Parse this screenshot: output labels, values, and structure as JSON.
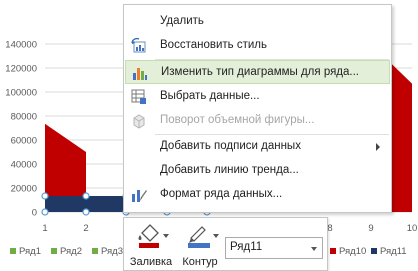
{
  "chart_data": {
    "type": "area",
    "y_ticks": [
      "0",
      "20000",
      "40000",
      "60000",
      "80000",
      "100000",
      "120000",
      "140000"
    ],
    "x_ticks": [
      "1",
      "2",
      "8",
      "9",
      "10"
    ],
    "ylim": [
      0,
      150000
    ],
    "grid": true,
    "legend_position": "bottom",
    "colors": {
      "red": "#c00000",
      "green": "#70ad47",
      "navy": "#203864"
    }
  },
  "legend": [
    {
      "label": "Ряд1",
      "color": "#70ad47"
    },
    {
      "label": "Ряд2",
      "color": "#70ad47"
    },
    {
      "label": "Ряд3",
      "color": "#70ad47"
    },
    {
      "label": "Ряд10",
      "color": "#c00000"
    },
    {
      "label": "Ряд11",
      "color": "#203864"
    }
  ],
  "context_menu": {
    "items": [
      {
        "label": "Удалить",
        "icon": "",
        "state": "normal"
      },
      {
        "label": "Восстановить стиль",
        "icon": "reset-style-icon",
        "state": "normal"
      },
      {
        "label": "Изменить тип диаграммы для ряда...",
        "icon": "change-chart-type-icon",
        "state": "highlighted"
      },
      {
        "label": "Выбрать данные...",
        "icon": "select-data-icon",
        "state": "normal"
      },
      {
        "label": "Поворот объемной фигуры...",
        "icon": "3d-rotation-icon",
        "state": "disabled"
      },
      {
        "label": "Добавить подписи данных",
        "icon": "",
        "state": "submenu"
      },
      {
        "label": "Добавить линию тренда...",
        "icon": "",
        "state": "normal"
      },
      {
        "label": "Формат ряда данных...",
        "icon": "format-series-icon",
        "state": "normal"
      }
    ]
  },
  "mini_toolbar": {
    "fill_label": "Заливка",
    "outline_label": "Контур",
    "series_value": "Ряд11"
  }
}
